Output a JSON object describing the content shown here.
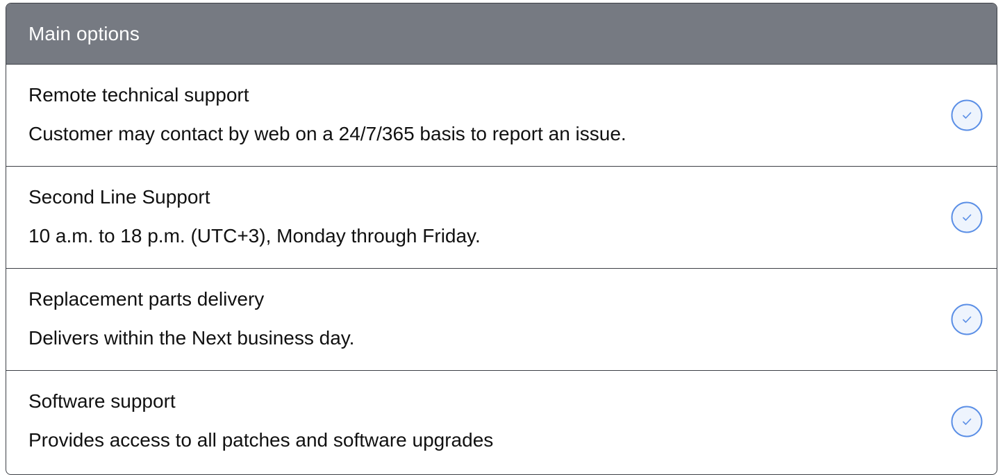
{
  "header": {
    "title": "Main options"
  },
  "options": [
    {
      "title": "Remote technical support",
      "description": "Customer may contact by web on a 24/7/365 basis to report an issue.",
      "icon": "check-circle-icon",
      "checked": true
    },
    {
      "title": "Second Line Support",
      "description": "10 a.m. to 18 p.m. (UTC+3), Monday through Friday.",
      "icon": "check-circle-icon",
      "checked": true
    },
    {
      "title": "Replacement parts delivery",
      "description": "Delivers within the Next business day.",
      "icon": "check-circle-icon",
      "checked": true
    },
    {
      "title": "Software support",
      "description": "Provides access to all patches and software upgrades",
      "icon": "check-circle-icon",
      "checked": true
    }
  ],
  "colors": {
    "header_bg": "#767a82",
    "border": "#3c3f45",
    "icon_accent": "#5b8fe6",
    "icon_fill": "#eef4fd"
  }
}
